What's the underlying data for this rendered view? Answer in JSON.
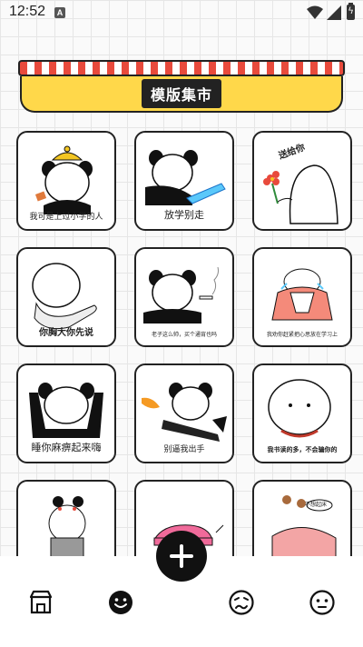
{
  "status_bar": {
    "time": "12:52",
    "notification_badge": "A",
    "battery_glyph": "ϟ"
  },
  "banner": {
    "title": "模版集市"
  },
  "templates": [
    {
      "caption": "我可是上过小学的人"
    },
    {
      "caption": "放学别走"
    },
    {
      "caption": "送给你"
    },
    {
      "caption": "你胸大你先说"
    },
    {
      "caption": "老子这么帅，买个通宵也吗"
    },
    {
      "caption": "我劝你赶紧把心思放在学习上"
    },
    {
      "caption": "睡你麻痹起来嗨"
    },
    {
      "caption": "别逼我出手"
    },
    {
      "caption": "我书读的多，不会骗你的"
    },
    {
      "caption": ""
    },
    {
      "caption": ""
    },
    {
      "caption": "不想起床"
    }
  ],
  "bottom_nav": {
    "items": [
      {
        "icon": "shop-icon"
      },
      {
        "icon": "smile-icon",
        "active": true
      },
      {
        "icon": "confused-face-icon"
      },
      {
        "icon": "neutral-face-icon"
      }
    ],
    "fab_icon": "plus-icon"
  },
  "colors": {
    "banner_yellow": "#ffd84a",
    "awning_red": "#e84a3c",
    "ink": "#222222"
  }
}
